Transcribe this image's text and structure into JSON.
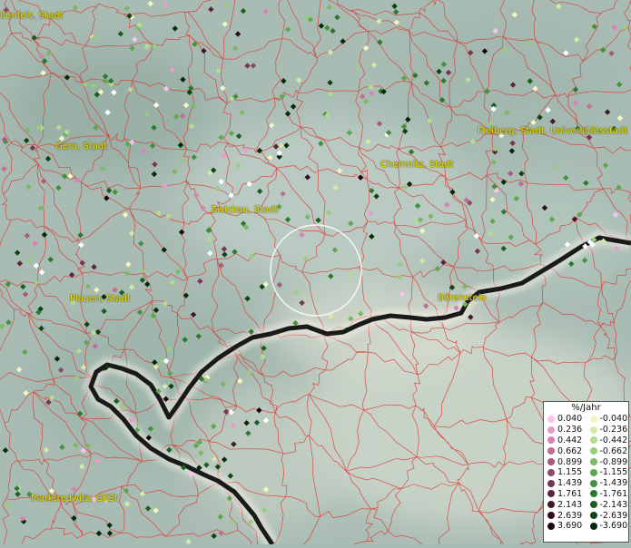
{
  "map": {
    "cities": [
      {
        "name": "ßenfels, Stadt"
      },
      {
        "name": "Gera, Stadt"
      },
      {
        "name": "Chemnitz, Stadt"
      },
      {
        "name": "Freiberg, Stadt, Universitätsstadt"
      },
      {
        "name": "Zwickau, Stadt"
      },
      {
        "name": "Plauen, Stadt"
      },
      {
        "name": "Bärenstein"
      },
      {
        "name": "Marktredwitz, GKSt"
      }
    ],
    "colors": {
      "background": "#a9bcb4",
      "border_lines": "#e0332e",
      "country_border": "#1a1a1a",
      "city_label": "#e8e400"
    }
  },
  "legend": {
    "title": "%/Jahr",
    "positive": [
      {
        "value": "0.040",
        "color": "#f6c4ef"
      },
      {
        "value": "0.236",
        "color": "#e89ccc"
      },
      {
        "value": "0.442",
        "color": "#d882b4"
      },
      {
        "value": "0.662",
        "color": "#c26c98"
      },
      {
        "value": "0.899",
        "color": "#a85a7e"
      },
      {
        "value": "1.155",
        "color": "#8e4868"
      },
      {
        "value": "1.439",
        "color": "#763652"
      },
      {
        "value": "1.761",
        "color": "#5c2440"
      },
      {
        "value": "2.143",
        "color": "#44162c"
      },
      {
        "value": "2.639",
        "color": "#2e0c1c"
      },
      {
        "value": "3.690",
        "color": "#1a0410"
      }
    ],
    "negative": [
      {
        "value": "-0.040",
        "color": "#f2f6c0"
      },
      {
        "value": "-0.236",
        "color": "#d2eaa6"
      },
      {
        "value": "-0.442",
        "color": "#b6dc92"
      },
      {
        "value": "-0.662",
        "color": "#98cc7e"
      },
      {
        "value": "-0.899",
        "color": "#7cb866"
      },
      {
        "value": "-1.155",
        "color": "#5ea650"
      },
      {
        "value": "-1.439",
        "color": "#44903e"
      },
      {
        "value": "-1.761",
        "color": "#2c782e"
      },
      {
        "value": "-2.143",
        "color": "#1a5e20"
      },
      {
        "value": "-2.639",
        "color": "#0c4414"
      },
      {
        "value": "-3.690",
        "color": "#042a0a"
      }
    ]
  }
}
